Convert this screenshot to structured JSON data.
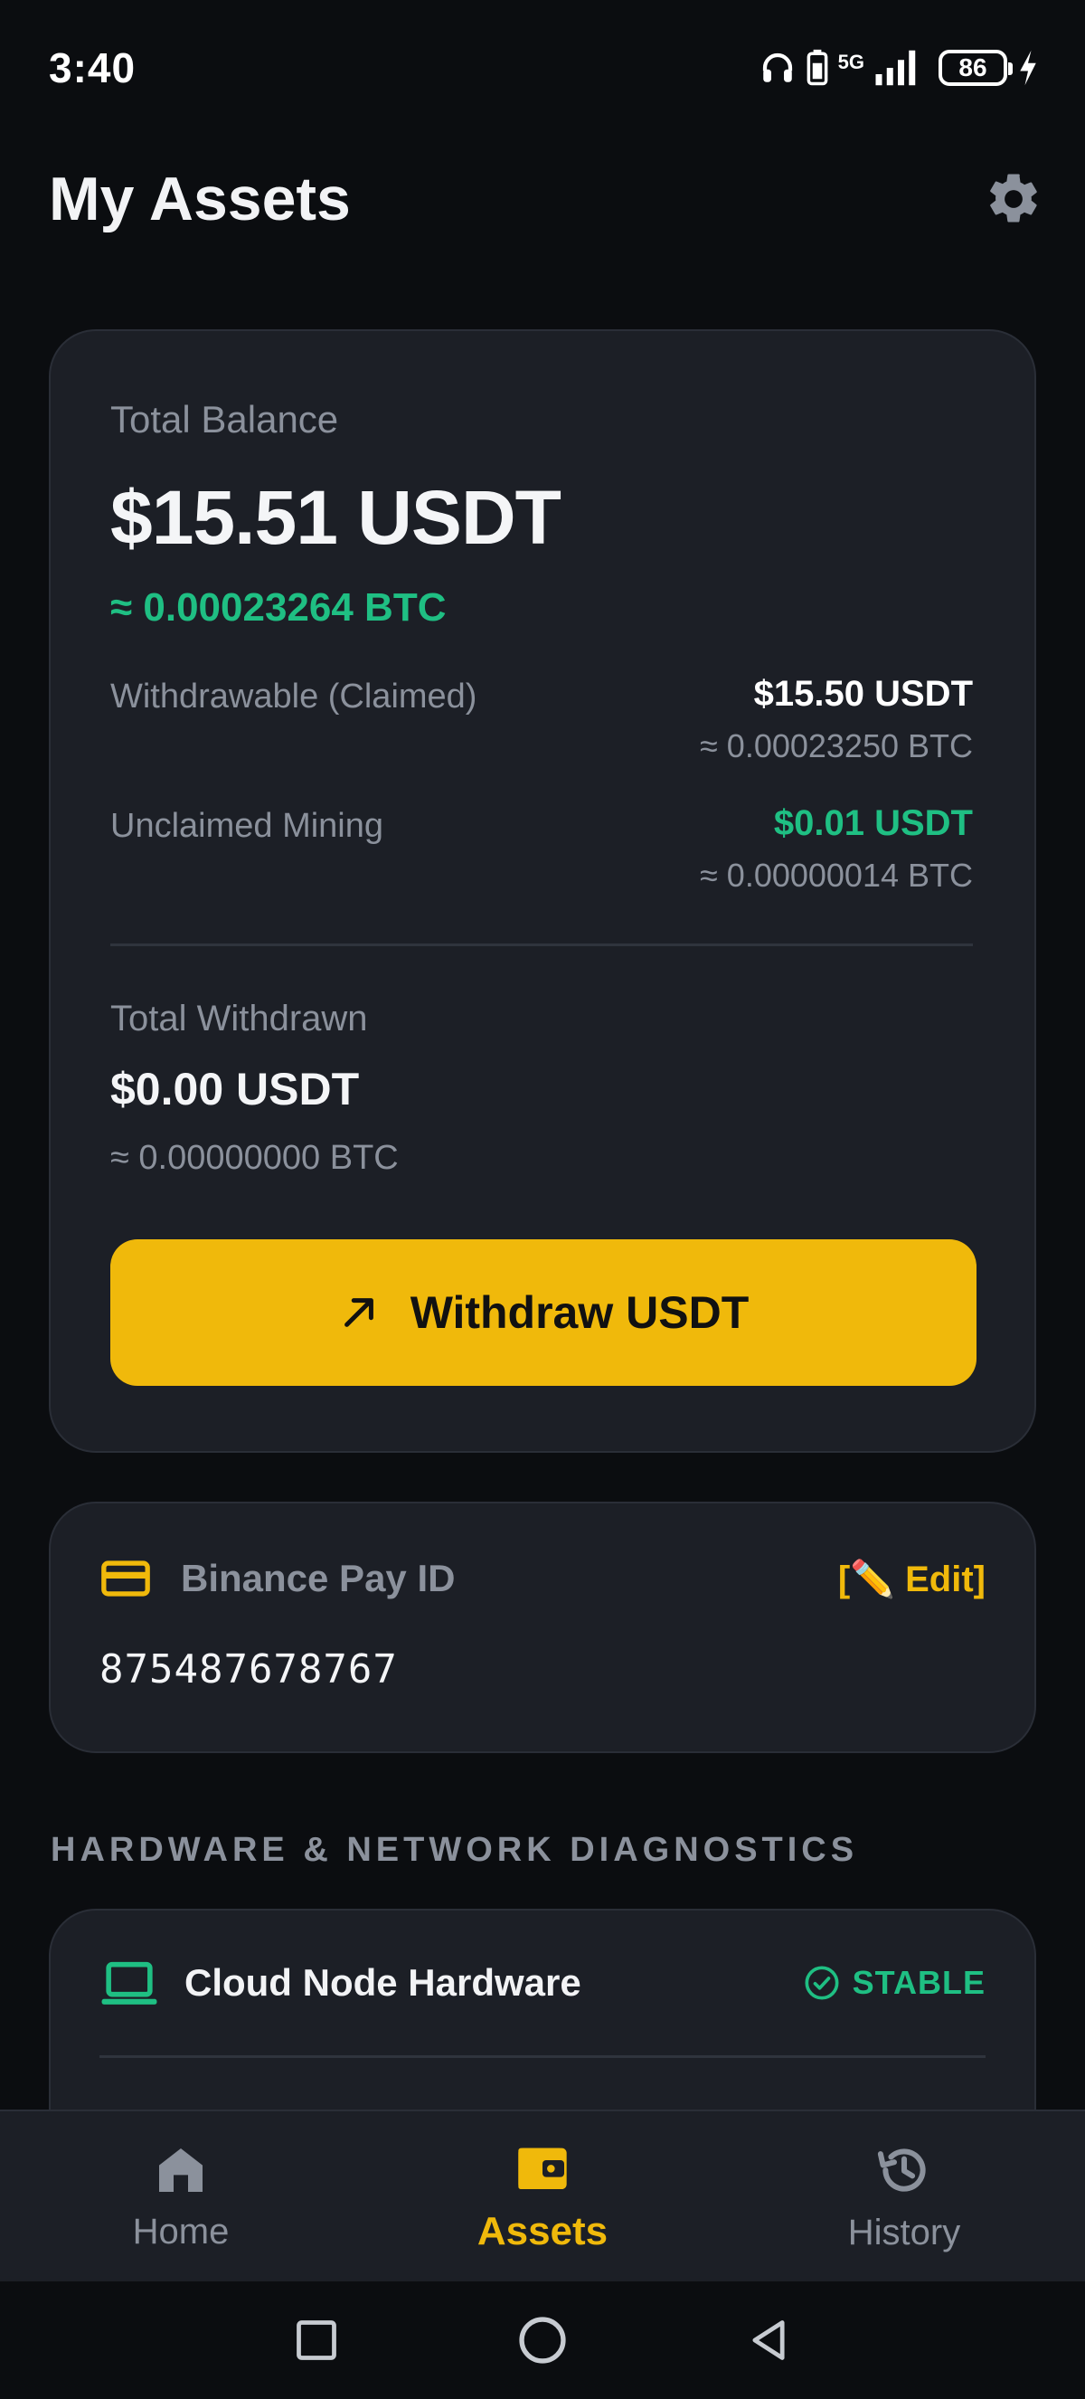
{
  "status_bar": {
    "time": "3:40",
    "network": "5G",
    "battery": "86"
  },
  "header": {
    "title": "My Assets",
    "settings_icon": "gear-icon"
  },
  "balance": {
    "total_label": "Total Balance",
    "total_amount": "$15.51 USDT",
    "total_btc": "≈ 0.00023264 BTC",
    "withdrawable_label": "Withdrawable (Claimed)",
    "withdrawable_amount": "$15.50 USDT",
    "withdrawable_btc": "≈ 0.00023250 BTC",
    "unclaimed_label": "Unclaimed Mining",
    "unclaimed_amount": "$0.01 USDT",
    "unclaimed_btc": "≈ 0.00000014 BTC",
    "withdrawn_label": "Total Withdrawn",
    "withdrawn_amount": "$0.00 USDT",
    "withdrawn_btc": "≈ 0.00000000 BTC",
    "withdraw_button": "Withdraw USDT"
  },
  "pay_id": {
    "title": "Binance Pay ID",
    "edit_label": "[✏️ Edit]",
    "value": "875487678767"
  },
  "diagnostics": {
    "section_title": "HARDWARE & NETWORK DIAGNOSTICS",
    "hardware_title": "Cloud Node Hardware",
    "hardware_status": "STABLE"
  },
  "bottom_nav": {
    "items": [
      {
        "label": "Home",
        "icon": "home-icon",
        "active": false
      },
      {
        "label": "Assets",
        "icon": "wallet-icon",
        "active": true
      },
      {
        "label": "History",
        "icon": "history-icon",
        "active": false
      }
    ]
  },
  "colors": {
    "background": "#0b0d10",
    "card": "#1c1f26",
    "accent": "#f0b90b",
    "positive": "#1fbf83",
    "muted": "#8b919c"
  }
}
